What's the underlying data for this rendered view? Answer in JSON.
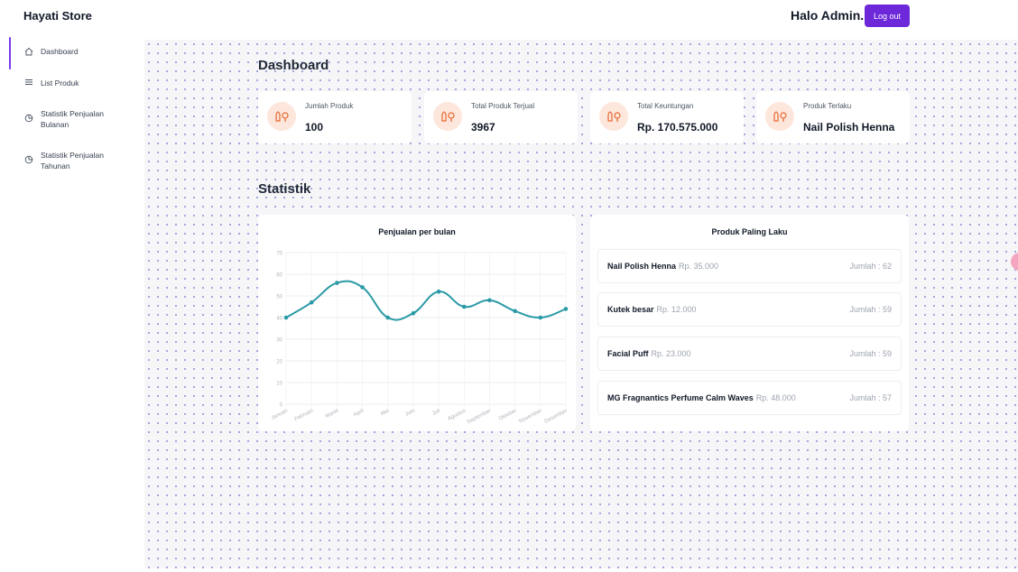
{
  "app": {
    "brand": "Hayati Store"
  },
  "header": {
    "greeting": "Halo Admin.",
    "logout_label": "Log out"
  },
  "sidebar": {
    "items": [
      {
        "label": "Dashboard",
        "icon": "home-icon",
        "active": true
      },
      {
        "label": "List Produk",
        "icon": "list-icon",
        "active": false
      },
      {
        "label": "Statistik Penjualan Bulanan",
        "icon": "pie-chart-icon",
        "active": false
      },
      {
        "label": "Statistik Penjualan Tahunan",
        "icon": "pie-chart-icon",
        "active": false
      }
    ]
  },
  "main": {
    "dashboard_title": "Dashboard",
    "stats": [
      {
        "label": "Jumlah Produk",
        "value": "100",
        "icon": "cosmetics-icon"
      },
      {
        "label": "Total Produk Terjual",
        "value": "3967",
        "icon": "cosmetics-icon"
      },
      {
        "label": "Total Keuntungan",
        "value": "Rp. 170.575.000",
        "icon": "cosmetics-icon"
      },
      {
        "label": "Produk Terlaku",
        "value": "Nail Polish Henna",
        "icon": "cosmetics-icon"
      }
    ],
    "statistik_title": "Statistik",
    "best_products": {
      "title": "Produk Paling Laku",
      "items": [
        {
          "name": "Nail Polish Henna",
          "price": "Rp. 35.000",
          "qty": "Jumlah : 62"
        },
        {
          "name": "Kutek besar",
          "price": "Rp. 12.000",
          "qty": "Jumlah : 59"
        },
        {
          "name": "Facial Puff",
          "price": "Rp. 23.000",
          "qty": "Jumlah : 59"
        },
        {
          "name": "MG Fragnantics Perfume Calm Waves",
          "price": "Rp. 48.000",
          "qty": "Jumlah : 57"
        }
      ]
    }
  },
  "colors": {
    "accent": "#6d28d9",
    "line": "#2a9aa6",
    "icon_bg": "#fde7dc",
    "icon_fg": "#e8662f"
  },
  "chart_data": {
    "type": "line",
    "title": "Penjualan per bulan",
    "categories": [
      "Januari",
      "Februari",
      "Maret",
      "April",
      "Mei",
      "Juni",
      "Juli",
      "Agustus",
      "September",
      "Oktober",
      "November",
      "Desember"
    ],
    "series": [
      {
        "values": [
          40,
          47,
          56,
          54,
          40,
          42,
          52,
          45,
          48,
          43,
          40,
          44
        ]
      }
    ],
    "ylim": [
      0,
      70
    ],
    "yticks": [
      0,
      10,
      20,
      30,
      40,
      50,
      60,
      70
    ],
    "grid": true,
    "xlabel": "",
    "ylabel": ""
  }
}
